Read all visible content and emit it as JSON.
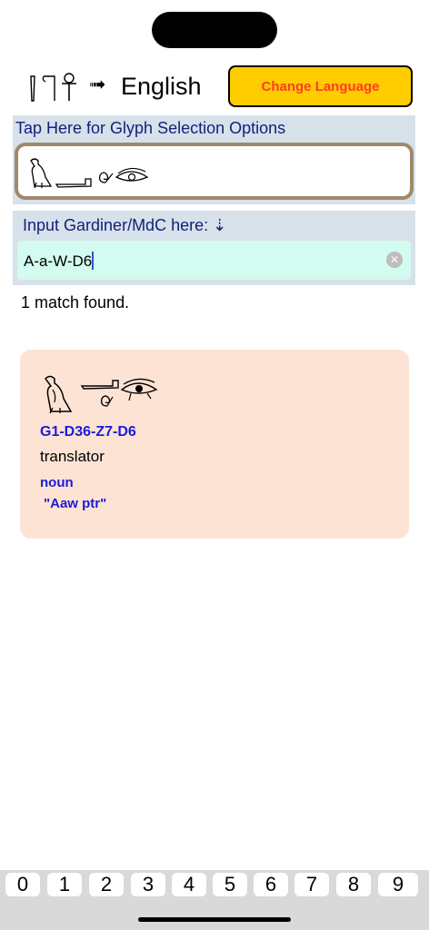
{
  "header": {
    "source_glyph_icon": "ankh-hieroglyph-icon",
    "arrow": "➟",
    "target_language": "English",
    "change_language_label": "Change Language"
  },
  "glyph_panel": {
    "label": "Tap Here for Glyph Selection Options",
    "glyph_icon": "hieroglyph-sequence-icon"
  },
  "input": {
    "label": "Input Gardiner/MdC here: ⇣",
    "value": "A-a-W-D6",
    "clear_icon": "clear-circle-icon"
  },
  "results": {
    "count_text": "1 match found.",
    "items": [
      {
        "glyph_icon": "vulture-arm-rope-eye-hieroglyphs",
        "code": "G1-D36-Z7-D6",
        "translation": "translator",
        "part_of_speech": "noun",
        "transliteration": " \"Aaw ptr\""
      }
    ]
  },
  "number_strip": [
    "0",
    "1",
    "2",
    "3",
    "4",
    "5",
    "6",
    "7",
    "8",
    "9"
  ],
  "colors": {
    "panel_bg": "#d6e1ea",
    "panel_text": "#16207a",
    "button_bg": "#ffcc00",
    "button_text": "#ff3b1f",
    "input_bg": "#d3fbef",
    "card_bg": "#fde3d4",
    "code_text": "#1b1bd6",
    "glyph_border": "#a0896a"
  }
}
